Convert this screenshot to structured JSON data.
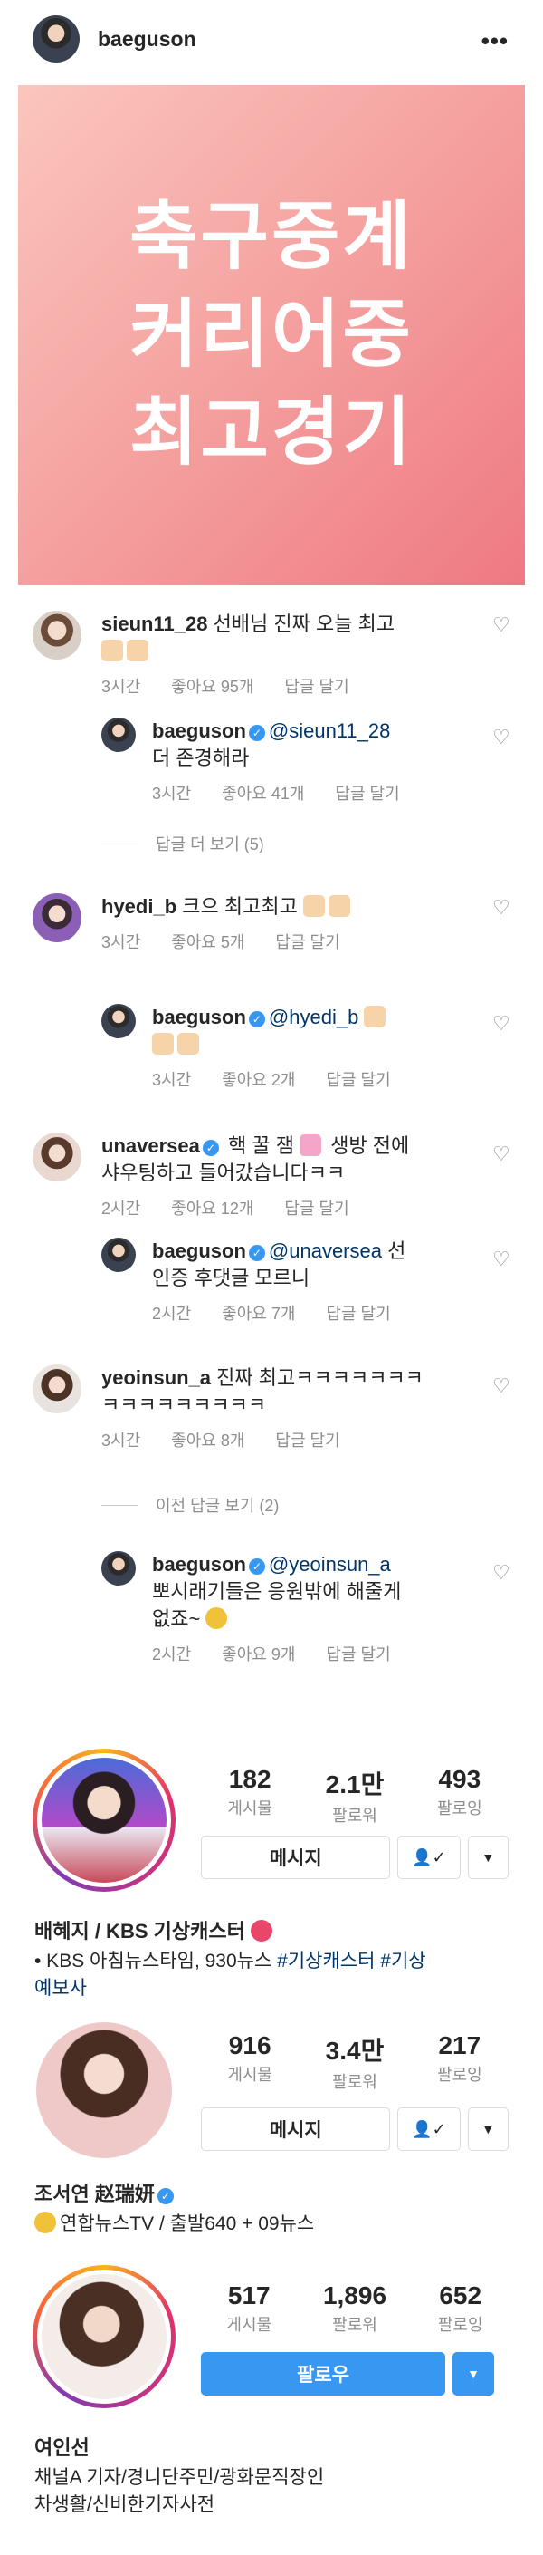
{
  "header": {
    "username": "baeguson",
    "more_icon": "more-horizontal-icon"
  },
  "post": {
    "lines": [
      "축구중계",
      "커리어중",
      "최고경기"
    ],
    "gradient": [
      "#fbc6bd",
      "#ef7983"
    ]
  },
  "comments": [
    {
      "user": "sieun11_28",
      "text": "선배님 진짜 오늘 최고",
      "time": "3시간",
      "likes": "좋아요 95개",
      "reply": "답글 달기"
    },
    {
      "user": "baeguson",
      "mention": "@sieun11_28",
      "text": "더 존경해라",
      "time": "3시간",
      "likes": "좋아요 41개",
      "reply": "답글 달기"
    },
    {
      "more": "답글 더 보기 (5)"
    },
    {
      "user": "hyedi_b",
      "text": "크으 최고최고",
      "time": "3시간",
      "likes": "좋아요 5개",
      "reply": "답글 달기"
    },
    {
      "user": "baeguson",
      "mention": "@hyedi_b",
      "text": "",
      "time": "3시간",
      "likes": "좋아요 2개",
      "reply": "답글 달기"
    },
    {
      "user": "unaversea",
      "text1": "핵 꿀 잼",
      "text2": "생방 전에",
      "text3": "샤우팅하고 들어갔습니다ㅋㅋ",
      "time": "2시간",
      "likes": "좋아요 12개",
      "reply": "답글 달기"
    },
    {
      "user": "baeguson",
      "mention": "@unaversea",
      "text1": "선",
      "text2": "인증 후댓글 모르니",
      "time": "2시간",
      "likes": "좋아요 7개",
      "reply": "답글 달기"
    },
    {
      "user": "yeoinsun_a",
      "text1": "진짜 최고ㅋㅋㅋㅋㅋㅋㅋ",
      "text2": "ㅋㅋㅋㅋㅋㅋㅋㅋㅋ",
      "time": "3시간",
      "likes": "좋아요 8개",
      "reply": "답글 달기"
    },
    {
      "more": "이전 답글 보기 (2)"
    },
    {
      "user": "baeguson",
      "mention": "@yeoinsun_a",
      "text1": "뽀시래기들은 응원밖에 해줄게",
      "text2": "없죠~",
      "time": "2시간",
      "likes": "좋아요 9개",
      "reply": "답글 달기"
    }
  ],
  "profiles": [
    {
      "posts": "182",
      "posts_label": "게시물",
      "followers": "2.1만",
      "followers_label": "팔로워",
      "following": "493",
      "following_label": "팔로잉",
      "button": "메시지",
      "name": "배혜지 / KBS 기상캐스터",
      "bio_line": "• KBS 아침뉴스타임, 930뉴스 ",
      "tag1": "#기상캐스터",
      "tag2": "#기상",
      "tag3": "예보사"
    },
    {
      "posts": "916",
      "posts_label": "게시물",
      "followers": "3.4만",
      "followers_label": "팔로워",
      "following": "217",
      "following_label": "팔로잉",
      "button": "메시지",
      "name": "조서연 赵瑞妍",
      "bio_line": "연합뉴스TV / 출발640 + 09뉴스"
    },
    {
      "posts": "517",
      "posts_label": "게시물",
      "followers": "1,896",
      "followers_label": "팔로워",
      "following": "652",
      "following_label": "팔로잉",
      "button": "팔로우",
      "name": "여인선",
      "bio_line1": "채널A 기자/경니단주민/광화문직장인",
      "bio_line2": "차생활/신비한기자사전"
    }
  ],
  "colors": {
    "accent": "#3897f0",
    "mention": "#003569",
    "muted": "#8e8e8e"
  }
}
